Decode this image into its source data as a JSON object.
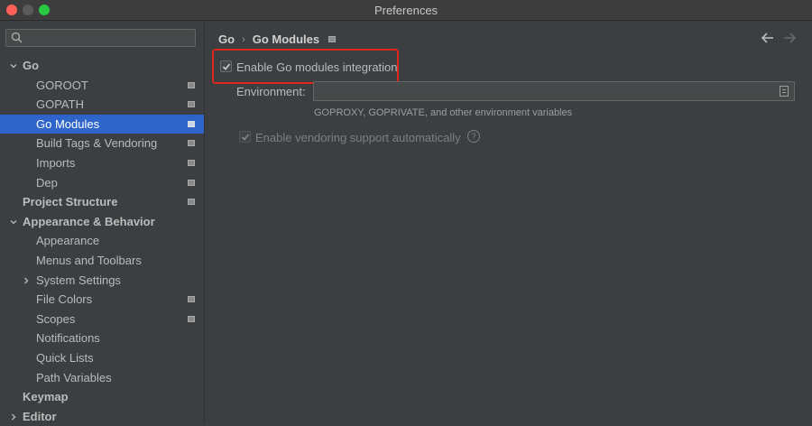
{
  "window": {
    "title": "Preferences"
  },
  "search": {
    "placeholder": "",
    "value": ""
  },
  "sidebar": {
    "items": [
      {
        "label": "Go",
        "level": 0,
        "bold": true,
        "expanded": true,
        "arrow": "down",
        "proj": false,
        "selected": false
      },
      {
        "label": "GOROOT",
        "level": 1,
        "bold": false,
        "arrow": "",
        "proj": true,
        "selected": false
      },
      {
        "label": "GOPATH",
        "level": 1,
        "bold": false,
        "arrow": "",
        "proj": true,
        "selected": false
      },
      {
        "label": "Go Modules",
        "level": 1,
        "bold": false,
        "arrow": "",
        "proj": true,
        "selected": true
      },
      {
        "label": "Build Tags & Vendoring",
        "level": 1,
        "bold": false,
        "arrow": "",
        "proj": true,
        "selected": false
      },
      {
        "label": "Imports",
        "level": 1,
        "bold": false,
        "arrow": "",
        "proj": true,
        "selected": false
      },
      {
        "label": "Dep",
        "level": 1,
        "bold": false,
        "arrow": "",
        "proj": true,
        "selected": false
      },
      {
        "label": "Project Structure",
        "level": 0,
        "bold": true,
        "arrow": "",
        "proj": true,
        "selected": false
      },
      {
        "label": "Appearance & Behavior",
        "level": 0,
        "bold": true,
        "arrow": "down",
        "proj": false,
        "selected": false
      },
      {
        "label": "Appearance",
        "level": 1,
        "bold": false,
        "arrow": "",
        "proj": false,
        "selected": false
      },
      {
        "label": "Menus and Toolbars",
        "level": 1,
        "bold": false,
        "arrow": "",
        "proj": false,
        "selected": false
      },
      {
        "label": "System Settings",
        "level": 1,
        "bold": false,
        "arrow": "right",
        "proj": false,
        "selected": false
      },
      {
        "label": "File Colors",
        "level": 1,
        "bold": false,
        "arrow": "",
        "proj": true,
        "selected": false
      },
      {
        "label": "Scopes",
        "level": 1,
        "bold": false,
        "arrow": "",
        "proj": true,
        "selected": false
      },
      {
        "label": "Notifications",
        "level": 1,
        "bold": false,
        "arrow": "",
        "proj": false,
        "selected": false
      },
      {
        "label": "Quick Lists",
        "level": 1,
        "bold": false,
        "arrow": "",
        "proj": false,
        "selected": false
      },
      {
        "label": "Path Variables",
        "level": 1,
        "bold": false,
        "arrow": "",
        "proj": false,
        "selected": false
      },
      {
        "label": "Keymap",
        "level": 0,
        "bold": true,
        "arrow": "",
        "proj": false,
        "selected": false
      },
      {
        "label": "Editor",
        "level": 0,
        "bold": true,
        "arrow": "right",
        "proj": false,
        "selected": false
      }
    ]
  },
  "main": {
    "breadcrumb": {
      "parent": "Go",
      "separator": "›",
      "current": "Go Modules"
    },
    "enable_modules": {
      "label": "Enable Go modules integration",
      "checked": true
    },
    "environment": {
      "label": "Environment:",
      "value": "",
      "hint": "GOPROXY, GOPRIVATE, and other environment variables"
    },
    "vendoring": {
      "label": "Enable vendoring support automatically",
      "checked": true,
      "enabled": false,
      "help": "?"
    }
  },
  "colors": {
    "selection": "#2f65ca",
    "highlight_border": "#e0261b",
    "background": "#3c3f41"
  },
  "icons": {
    "back": "arrow-left-icon",
    "forward": "arrow-right-icon",
    "search": "search-icon",
    "project_scope": "project-scope-icon"
  }
}
